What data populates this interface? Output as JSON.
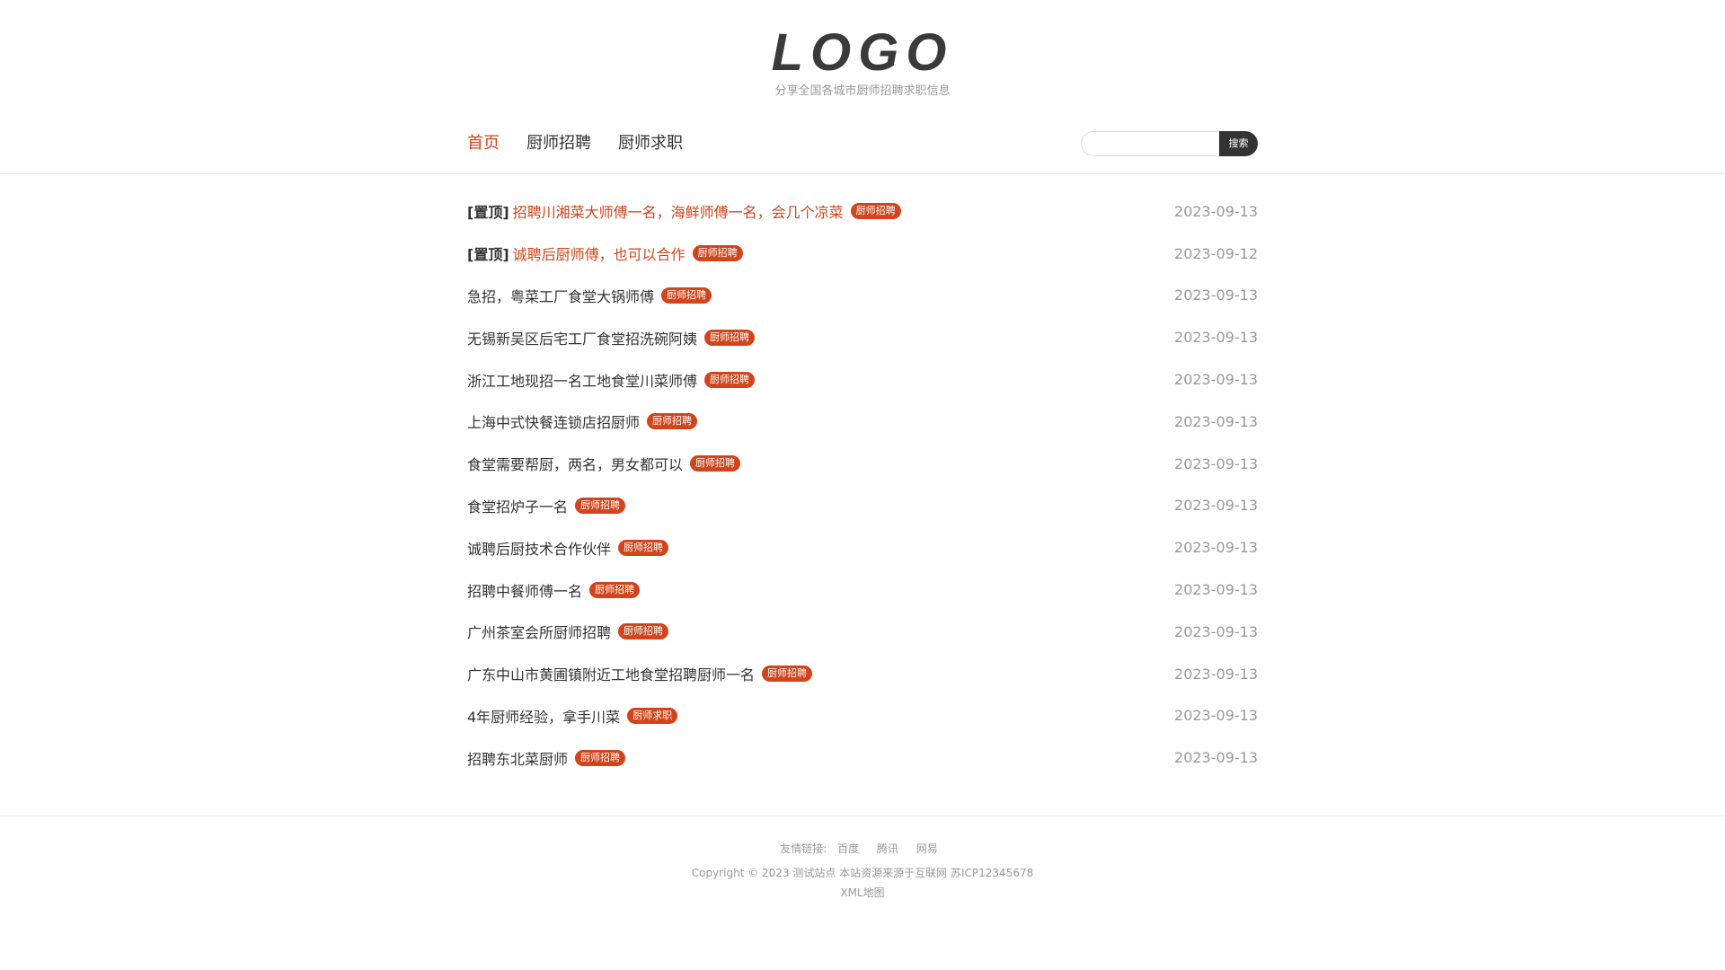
{
  "header": {
    "logo": "LOGO",
    "tagline": "分享全国各城市厨师招聘求职信息"
  },
  "nav": {
    "items": [
      {
        "label": "首页",
        "active": true
      },
      {
        "label": "厨师招聘",
        "active": false
      },
      {
        "label": "厨师求职",
        "active": false
      }
    ]
  },
  "search": {
    "placeholder": "",
    "value": "",
    "button_label": "搜索"
  },
  "list": {
    "items": [
      {
        "pin": "[置顶]",
        "title": "招聘川湘菜大师傅一名，海鲜师傅一名，会几个凉菜",
        "badge": "厨师招聘",
        "date": "2023-09-13",
        "highlight": true
      },
      {
        "pin": "[置顶]",
        "title": "诚聘后厨师傅，也可以合作",
        "badge": "厨师招聘",
        "date": "2023-09-12",
        "highlight": true
      },
      {
        "pin": "",
        "title": "急招，粤菜工厂食堂大锅师傅",
        "badge": "厨师招聘",
        "date": "2023-09-13",
        "highlight": false
      },
      {
        "pin": "",
        "title": "无锡新吴区后宅工厂食堂招洗碗阿姨",
        "badge": "厨师招聘",
        "date": "2023-09-13",
        "highlight": false
      },
      {
        "pin": "",
        "title": "浙江工地现招一名工地食堂川菜师傅",
        "badge": "厨师招聘",
        "date": "2023-09-13",
        "highlight": false
      },
      {
        "pin": "",
        "title": "上海中式快餐连锁店招厨师",
        "badge": "厨师招聘",
        "date": "2023-09-13",
        "highlight": false
      },
      {
        "pin": "",
        "title": "食堂需要帮厨，两名，男女都可以",
        "badge": "厨师招聘",
        "date": "2023-09-13",
        "highlight": false
      },
      {
        "pin": "",
        "title": "食堂招炉子一名",
        "badge": "厨师招聘",
        "date": "2023-09-13",
        "highlight": false
      },
      {
        "pin": "",
        "title": "诚聘后厨技术合作伙伴",
        "badge": "厨师招聘",
        "date": "2023-09-13",
        "highlight": false
      },
      {
        "pin": "",
        "title": "招聘中餐师傅一名",
        "badge": "厨师招聘",
        "date": "2023-09-13",
        "highlight": false
      },
      {
        "pin": "",
        "title": "广州茶室会所厨师招聘",
        "badge": "厨师招聘",
        "date": "2023-09-13",
        "highlight": false
      },
      {
        "pin": "",
        "title": "广东中山市黄圃镇附近工地食堂招聘厨师一名",
        "badge": "厨师招聘",
        "date": "2023-09-13",
        "highlight": false
      },
      {
        "pin": "",
        "title": "4年厨师经验，拿手川菜",
        "badge": "厨师求职",
        "date": "2023-09-13",
        "highlight": false
      },
      {
        "pin": "",
        "title": "招聘东北菜厨师",
        "badge": "厨师招聘",
        "date": "2023-09-13",
        "highlight": false
      }
    ]
  },
  "footer": {
    "links_label": "友情链接:",
    "links": [
      "百度",
      "腾讯",
      "网易"
    ],
    "copyright": "Copyright © 2023 测试站点 本站资源来源于互联网 苏ICP12345678",
    "sitemap": "XML地图"
  },
  "colors": {
    "accent": "#d2441b",
    "text": "#333333",
    "muted": "#999999",
    "button_dark": "#333333"
  }
}
